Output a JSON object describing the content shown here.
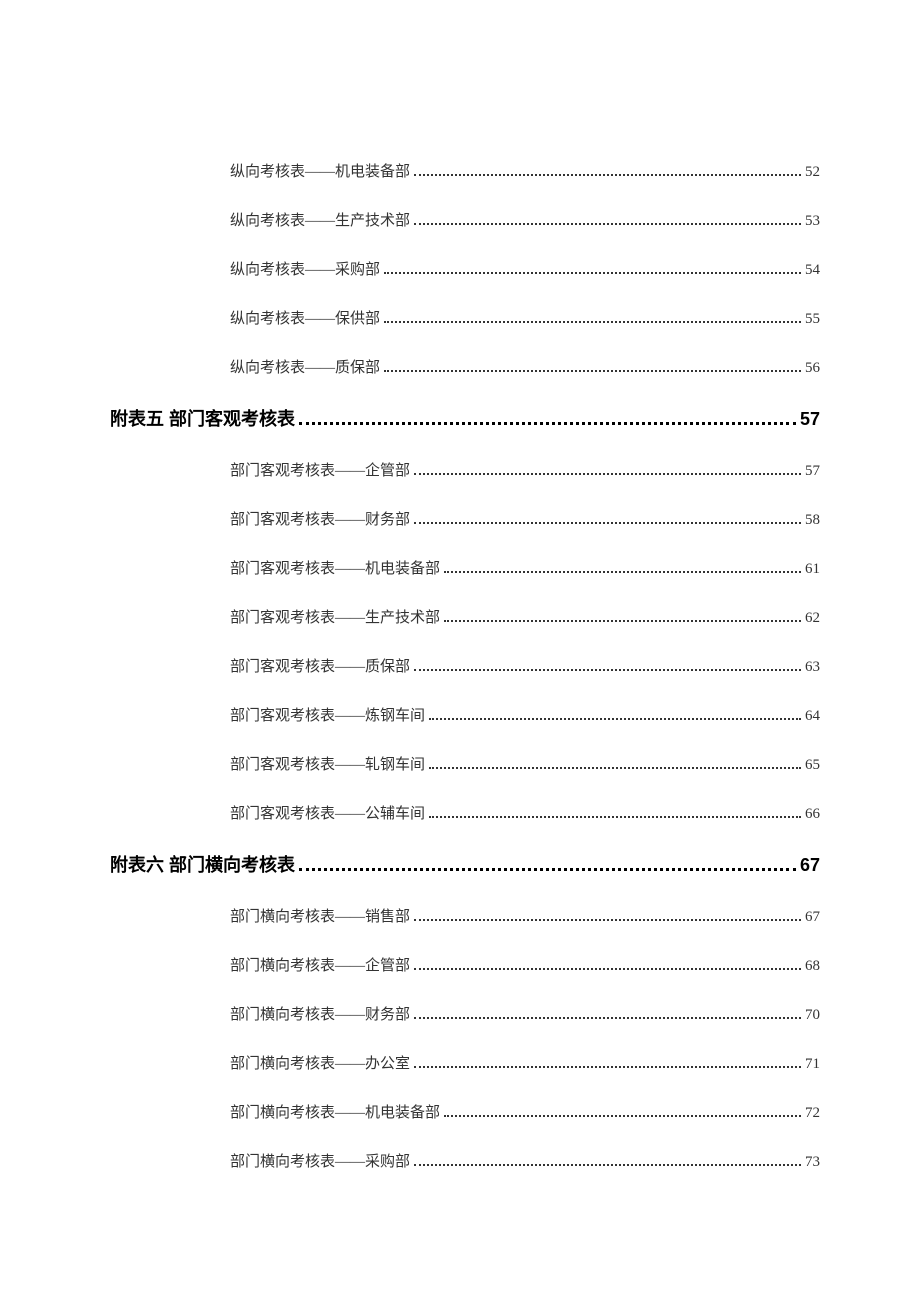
{
  "toc": [
    {
      "level": "sub",
      "title": "纵向考核表——机电装备部",
      "page": "52"
    },
    {
      "level": "sub",
      "title": "纵向考核表——生产技术部",
      "page": "53"
    },
    {
      "level": "sub",
      "title": "纵向考核表——采购部",
      "page": "54"
    },
    {
      "level": "sub",
      "title": "纵向考核表——保供部",
      "page": "55"
    },
    {
      "level": "sub",
      "title": "纵向考核表——质保部",
      "page": "56"
    },
    {
      "level": "section",
      "title": "附表五  部门客观考核表",
      "page": "57"
    },
    {
      "level": "sub",
      "title": "部门客观考核表——企管部",
      "page": "57"
    },
    {
      "level": "sub",
      "title": "部门客观考核表——财务部",
      "page": "58"
    },
    {
      "level": "sub",
      "title": "部门客观考核表——机电装备部",
      "page": "61"
    },
    {
      "level": "sub",
      "title": "部门客观考核表——生产技术部",
      "page": "62"
    },
    {
      "level": "sub",
      "title": "部门客观考核表——质保部",
      "page": "63"
    },
    {
      "level": "sub",
      "title": "部门客观考核表——炼钢车间",
      "page": "64"
    },
    {
      "level": "sub",
      "title": "部门客观考核表——轧钢车间",
      "page": "65"
    },
    {
      "level": "sub",
      "title": "部门客观考核表——公辅车间",
      "page": "66"
    },
    {
      "level": "section",
      "title": "附表六  部门横向考核表",
      "page": "67"
    },
    {
      "level": "sub",
      "title": "部门横向考核表——销售部",
      "page": "67"
    },
    {
      "level": "sub",
      "title": "部门横向考核表——企管部",
      "page": "68"
    },
    {
      "level": "sub",
      "title": "部门横向考核表——财务部",
      "page": "70"
    },
    {
      "level": "sub",
      "title": "部门横向考核表——办公室",
      "page": "71"
    },
    {
      "level": "sub",
      "title": "部门横向考核表——机电装备部",
      "page": "72"
    },
    {
      "level": "sub",
      "title": "部门横向考核表——采购部",
      "page": "73"
    }
  ]
}
